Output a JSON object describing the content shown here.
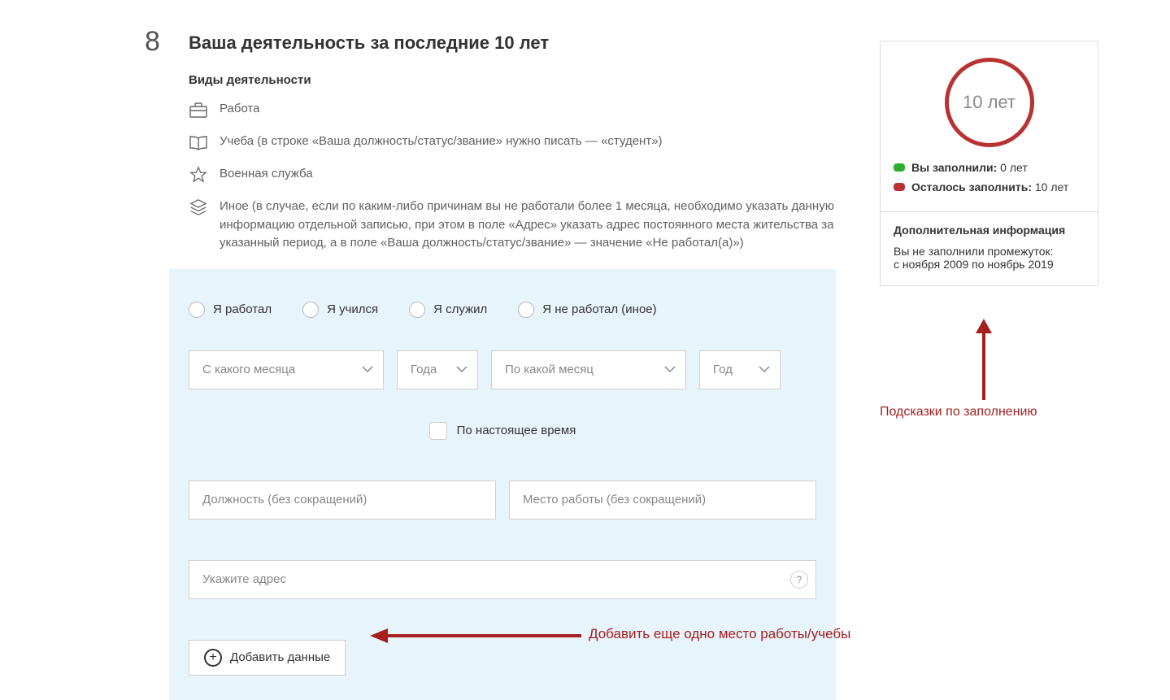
{
  "step": {
    "number": "8",
    "title": "Ваша деятельность за последние 10 лет"
  },
  "subtitle": "Виды деятельности",
  "activities": {
    "work": "Работа",
    "study": "Учеба (в строке «Ваша должность/статус/звание» нужно писать — «студент»)",
    "military": "Военная служба",
    "other": "Иное (в случае, если по каким-либо причинам вы не работали более 1 месяца, необходимо указать данную информацию отдельной записью, при этом в поле «Адрес» указать адрес постоянного места жительства за указанный период, а в поле «Ваша должность/статус/звание» — значение «Не работал(а)»)"
  },
  "radios": {
    "worked": "Я работал",
    "studied": "Я учился",
    "served": "Я служил",
    "none": "Я не работал (иное)"
  },
  "selects": {
    "from_month": "С какого месяца",
    "from_year": "Года",
    "to_month": "По какой месяц",
    "to_year": "Год"
  },
  "checkbox": {
    "present": "По настоящее время"
  },
  "inputs": {
    "position": "Должность (без сокращений)",
    "place": "Место работы (без сокращений)",
    "address": "Укажите адрес"
  },
  "help_char": "?",
  "add_btn": "Добавить данные",
  "side": {
    "ring": "10 лет",
    "filled_label": "Вы заполнили:",
    "filled_value": " 0 лет",
    "remain_label": "Осталось заполнить:",
    "remain_value": " 10 лет",
    "extra_title": "Дополнительная информация",
    "extra_line1": "Вы не заполнили промежуток:",
    "extra_line2": "с ноября 2009 по ноябрь 2019"
  },
  "annotations": {
    "hint_side": "Подсказки по заполнению",
    "hint_add": "Добавить еще одно место работы/учебы"
  }
}
